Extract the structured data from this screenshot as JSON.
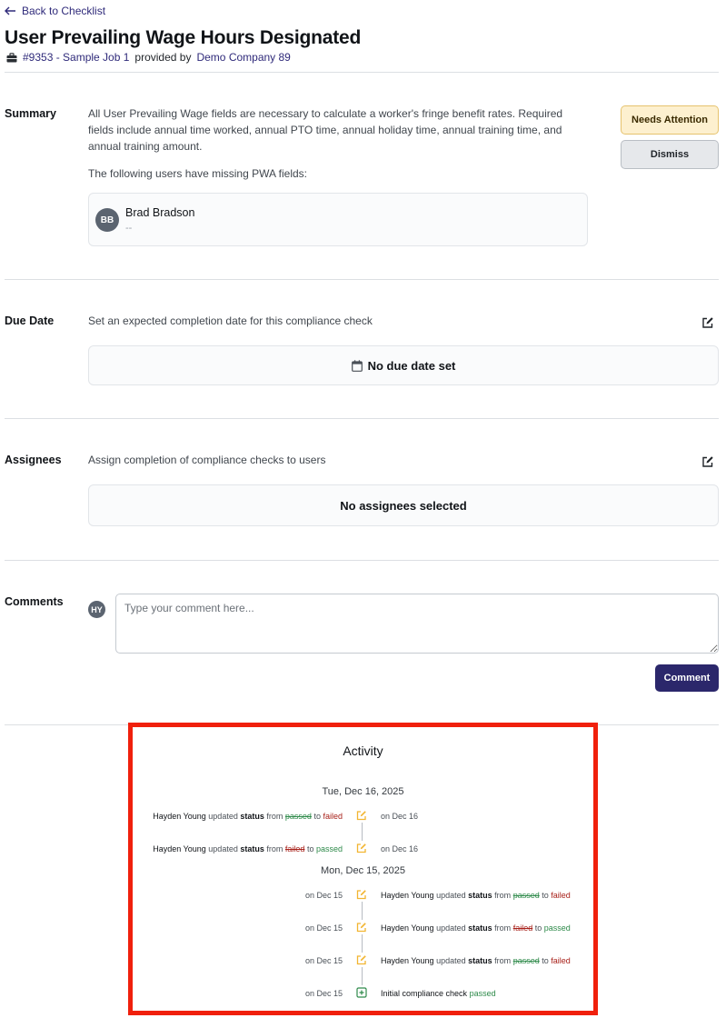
{
  "nav": {
    "back_label": "Back to Checklist"
  },
  "header": {
    "title": "User Prevailing Wage Hours Designated",
    "job_link": "#9353 - Sample Job 1",
    "provided_by": "provided by",
    "company_link": "Demo Company 89"
  },
  "summary": {
    "label": "Summary",
    "description": "All User Prevailing Wage fields are necessary to calculate a worker's fringe benefit rates. Required fields include annual time worked, annual PTO time, annual holiday time, annual training time, and annual training amount.",
    "missing_heading": "The following users have missing PWA fields:",
    "users": [
      {
        "initials": "BB",
        "name": "Brad Bradson",
        "detail": "--"
      }
    ],
    "needs_attention_label": "Needs Attention",
    "dismiss_label": "Dismiss"
  },
  "due_date": {
    "label": "Due Date",
    "description": "Set an expected completion date for this compliance check",
    "value": "No due date set"
  },
  "assignees": {
    "label": "Assignees",
    "description": "Assign completion of compliance checks to users",
    "value": "No assignees selected"
  },
  "comments": {
    "label": "Comments",
    "avatar_initials": "HY",
    "placeholder": "Type your comment here...",
    "submit_label": "Comment"
  },
  "activity": {
    "title": "Activity",
    "groups": [
      {
        "date": "Tue, Dec 16, 2025",
        "entries": [
          {
            "actor": "Hayden Young",
            "verb": "updated",
            "field": "status",
            "from_word": "from",
            "from": "passed",
            "to_word": "to",
            "to": "failed",
            "on": "on Dec 16"
          },
          {
            "actor": "Hayden Young",
            "verb": "updated",
            "field": "status",
            "from_word": "from",
            "from": "failed",
            "to_word": "to",
            "to": "passed",
            "on": "on Dec 16"
          }
        ]
      },
      {
        "date": "Mon, Dec 15, 2025",
        "entries": [
          {
            "actor": "Hayden Young",
            "verb": "updated",
            "field": "status",
            "from_word": "from",
            "from": "passed",
            "to_word": "to",
            "to": "failed",
            "on": "on Dec 15"
          },
          {
            "actor": "Hayden Young",
            "verb": "updated",
            "field": "status",
            "from_word": "from",
            "from": "failed",
            "to_word": "to",
            "to": "passed",
            "on": "on Dec 15"
          },
          {
            "actor": "Hayden Young",
            "verb": "updated",
            "field": "status",
            "from_word": "from",
            "from": "passed",
            "to_word": "to",
            "to": "failed",
            "on": "on Dec 15"
          },
          {
            "initial_text": "Initial compliance check",
            "result": "passed",
            "on": "on Dec 15"
          }
        ]
      }
    ]
  },
  "colors": {
    "accent": "#2b276b",
    "highlight_border": "#f0200c",
    "passed": "#2e8a4a",
    "failed": "#a8211a",
    "edit_icon": "#f2b531"
  }
}
